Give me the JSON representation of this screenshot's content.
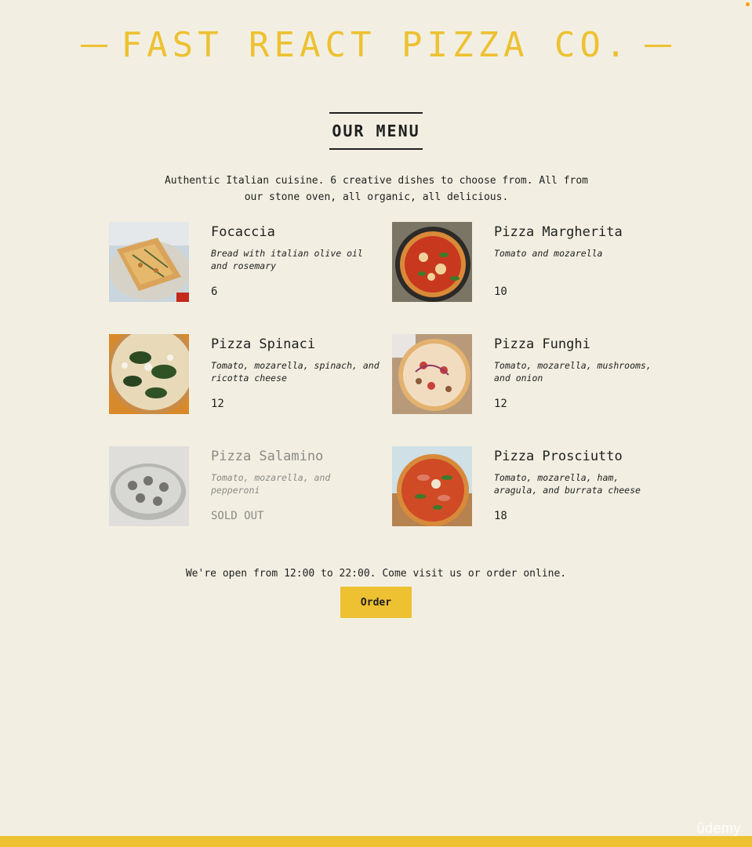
{
  "header": {
    "title": "FAST REACT PIZZA CO."
  },
  "menu": {
    "title": "OUR MENU",
    "intro": "Authentic Italian cuisine. 6 creative dishes to choose from. All from our stone oven, all organic, all delicious."
  },
  "pizzas": [
    {
      "name": "Focaccia",
      "ingredients": "Bread with italian olive oil and rosemary",
      "price": "6"
    },
    {
      "name": "Pizza Margherita",
      "ingredients": "Tomato and mozarella",
      "price": "10"
    },
    {
      "name": "Pizza Spinaci",
      "ingredients": "Tomato, mozarella, spinach, and ricotta cheese",
      "price": "12"
    },
    {
      "name": "Pizza Funghi",
      "ingredients": "Tomato, mozarella, mushrooms, and onion",
      "price": "12"
    },
    {
      "name": "Pizza Salamino",
      "ingredients": "Tomato, mozarella, and pepperoni",
      "price": "SOLD OUT"
    },
    {
      "name": "Pizza Prosciutto",
      "ingredients": "Tomato, mozarella, ham, aragula, and burrata cheese",
      "price": "18"
    }
  ],
  "footer": {
    "text": "We're open from 12:00 to 22:00. Come visit us or order online.",
    "order_label": "Order"
  },
  "watermark": "ûdemy",
  "colors": {
    "accent": "#edc131",
    "background": "#f2efe2",
    "text": "#1f1f1f"
  }
}
